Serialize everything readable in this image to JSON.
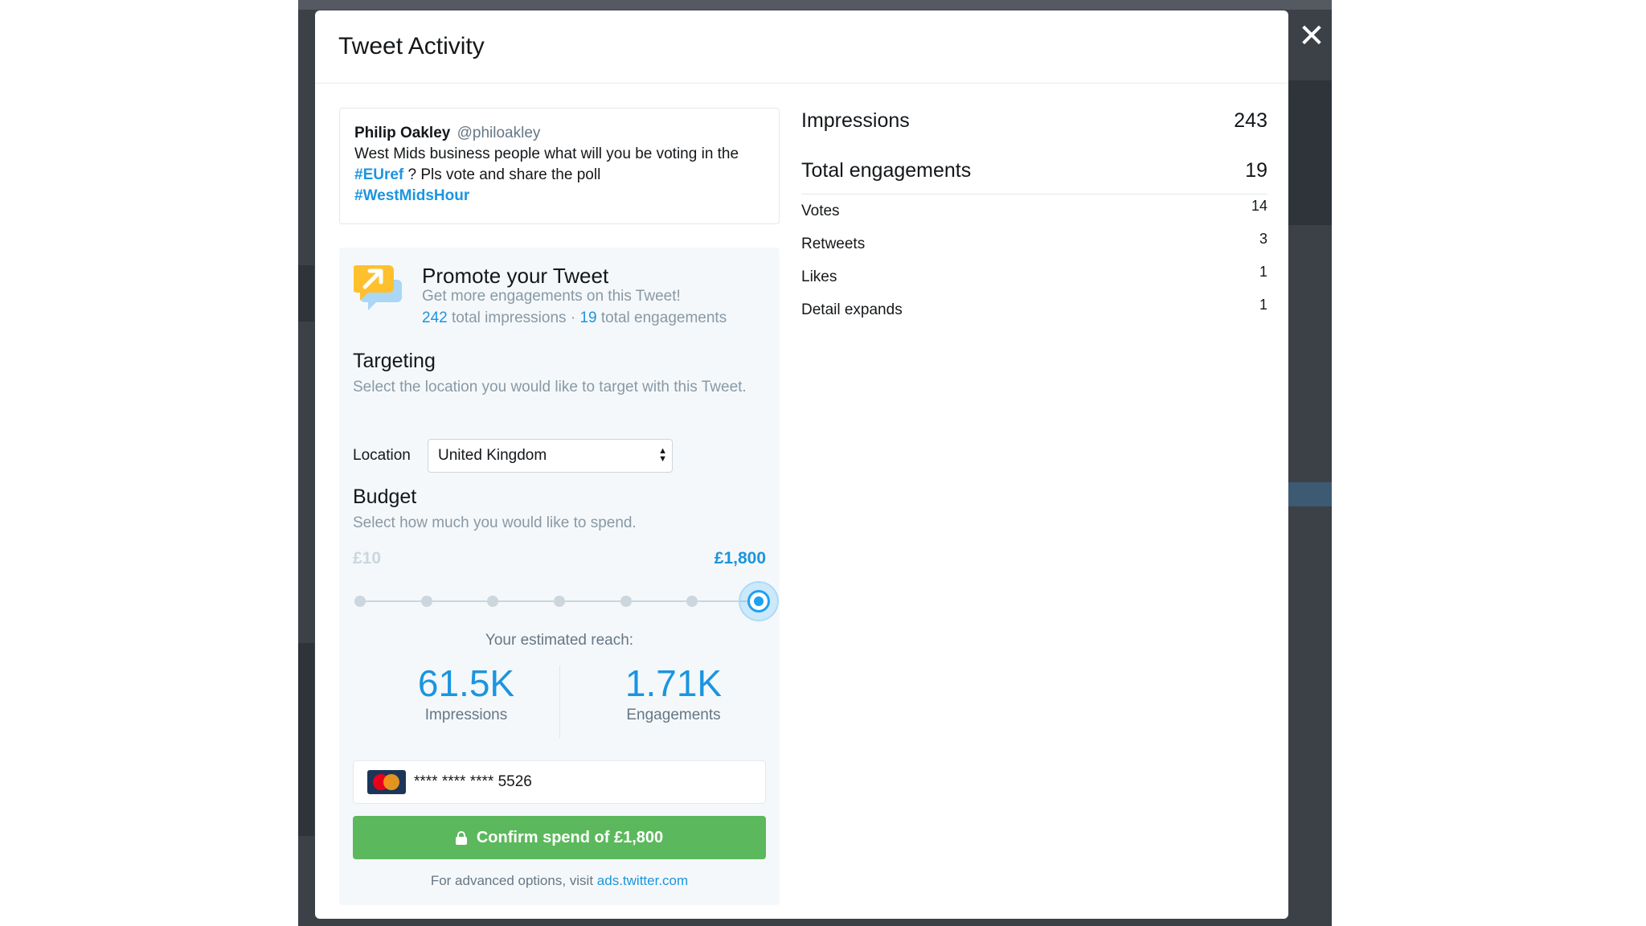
{
  "modal": {
    "title": "Tweet Activity",
    "close_label": "✕"
  },
  "tweet": {
    "name": "Philip Oakley",
    "handle": "@philoakley",
    "text_part1": "West Mids business people what will you be voting in the ",
    "hashtag1": "#EUref",
    "text_part2": " ? Pls vote and share the poll ",
    "hashtag2": "#WestMidsHour"
  },
  "promote": {
    "title": "Promote your Tweet",
    "subtitle": "Get more engagements on this Tweet!",
    "impressions_count": "242",
    "impressions_label": "total impressions",
    "separator": "·",
    "engagements_count": "19",
    "engagements_label": "total engagements",
    "icon": "promote-arrow-icon"
  },
  "targeting": {
    "title": "Targeting",
    "description": "Select the location you would like to target with this Tweet.",
    "location_label": "Location",
    "location_value": "United Kingdom"
  },
  "budget": {
    "title": "Budget",
    "description": "Select how much you would like to spend.",
    "min_label": "£10",
    "max_label": "£1,800",
    "steps": 7,
    "selected_step": 7
  },
  "reach": {
    "label": "Your estimated reach:",
    "impressions_value": "61.5K",
    "impressions_caption": "Impressions",
    "engagements_value": "1.71K",
    "engagements_caption": "Engagements"
  },
  "payment": {
    "card_masked": "**** **** **** 5526",
    "card_icon": "mastercard-icon"
  },
  "confirm": {
    "label": "Confirm spend of £1,800",
    "icon": "lock-icon"
  },
  "advanced": {
    "prefix": "For advanced options, visit ",
    "link": "ads.twitter.com"
  },
  "stats": {
    "impressions_label": "Impressions",
    "impressions_value": "243",
    "engagements_label": "Total engagements",
    "engagements_value": "19",
    "breakdown": [
      {
        "label": "Votes",
        "value": "14"
      },
      {
        "label": "Retweets",
        "value": "3"
      },
      {
        "label": "Likes",
        "value": "1"
      },
      {
        "label": "Detail expands",
        "value": "1"
      }
    ]
  },
  "colors": {
    "accent": "#1b95e0",
    "confirm": "#5cb85c",
    "backdrop": "#3c4047"
  }
}
